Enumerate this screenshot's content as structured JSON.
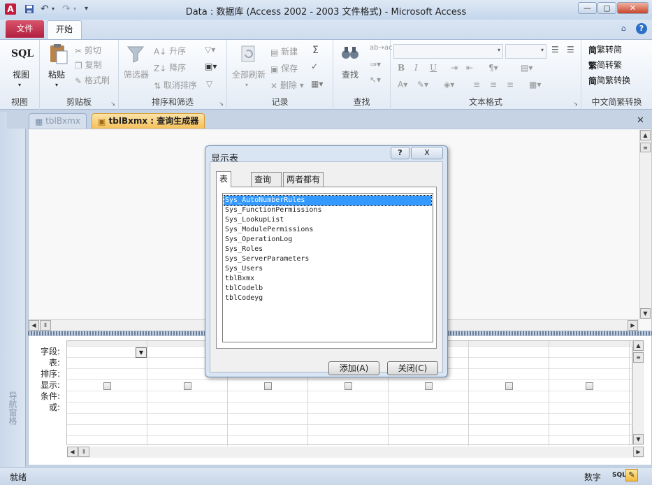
{
  "window": {
    "title": "Data : 数据库 (Access 2002 - 2003 文件格式)  -  Microsoft Access"
  },
  "ribbon_tabs": {
    "file": "文件",
    "home": "开始"
  },
  "groups": {
    "view": {
      "sql": "SQL",
      "view": "视图",
      "label": "视图"
    },
    "clipboard": {
      "paste": "粘贴",
      "cut": "剪切",
      "copy": "复制",
      "format_painter": "格式刷",
      "label": "剪贴板"
    },
    "sort": {
      "filter": "筛选器",
      "asc": "升序",
      "desc": "降序",
      "clear": "取消排序",
      "label": "排序和筛选"
    },
    "records": {
      "refresh": "全部刷新",
      "new": "新建",
      "save": "保存",
      "delete": "删除",
      "label": "记录"
    },
    "find": {
      "find": "查找",
      "label": "查找"
    },
    "text": {
      "label": "文本格式",
      "bold": "B",
      "italic": "I",
      "underline": "U"
    },
    "chinese": {
      "t2s": "繁转简",
      "s2t": "简转繁",
      "convert": "简繁转换",
      "label": "中文简繁转换"
    }
  },
  "doc_tabs": [
    {
      "label": "tblBxmx"
    },
    {
      "label": "tblBxmx : 查询生成器"
    }
  ],
  "nav_pane": {
    "label": "导航窗格"
  },
  "grid": {
    "row_labels": [
      "字段:",
      "表:",
      "排序:",
      "显示:",
      "条件:",
      "或:"
    ]
  },
  "dialog": {
    "title": "显示表",
    "help": "?",
    "close": "X",
    "tabs": [
      "表",
      "查询",
      "两者都有"
    ],
    "tables": [
      "Sys_AutoNumberRules",
      "Sys_FunctionPermissions",
      "Sys_LookupList",
      "Sys_ModulePermissions",
      "Sys_OperationLog",
      "Sys_Roles",
      "Sys_ServerParameters",
      "Sys_Users",
      "tblBxmx",
      "tblCodelb",
      "tblCodeyg"
    ],
    "selected_index": 0,
    "add_label": "添加(A)",
    "close_label": "关闭(C)"
  },
  "status": {
    "left": "就绪",
    "numlock": "数字",
    "sql": "SQL"
  },
  "colors": {
    "file_tab": "#b21f3f",
    "selection": "#3399ff",
    "active_tab": "#f7c66a"
  }
}
